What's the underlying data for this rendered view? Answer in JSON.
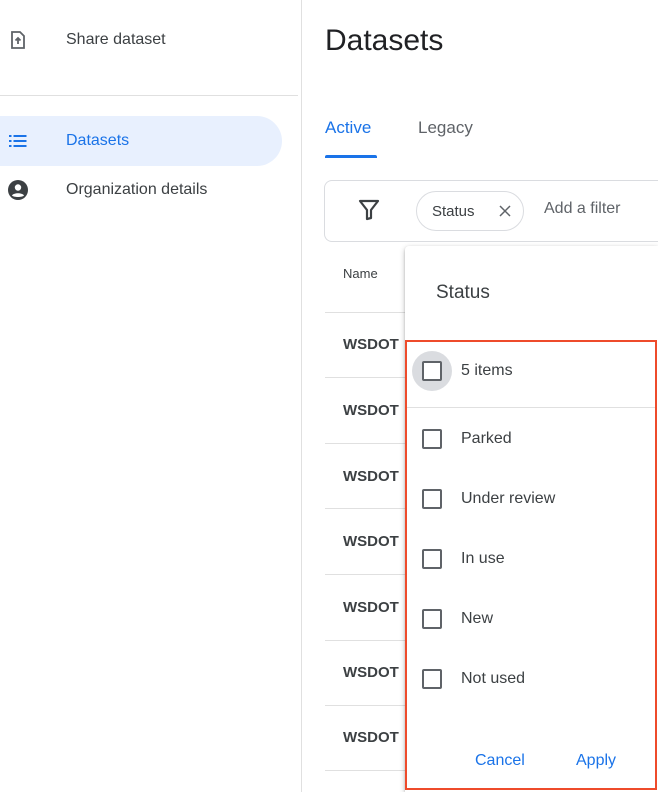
{
  "sidebar": {
    "items": [
      {
        "label": "Share dataset",
        "icon": "share-upload-icon"
      },
      {
        "label": "Datasets",
        "icon": "list-icon",
        "active": true
      },
      {
        "label": "Organization details",
        "icon": "account-circle-icon"
      }
    ]
  },
  "main": {
    "title": "Datasets",
    "tabs": [
      {
        "label": "Active",
        "active": true
      },
      {
        "label": "Legacy",
        "active": false
      }
    ],
    "filter": {
      "chip_label": "Status",
      "add_filter_label": "Add a filter"
    },
    "table": {
      "column_header": "Name",
      "rows": [
        "WSDOT",
        "WSDOT",
        "WSDOT",
        "WSDOT",
        "WSDOT",
        "WSDOT",
        "WSDOT"
      ]
    }
  },
  "status_popup": {
    "title": "Status",
    "select_all_label": "5 items",
    "options": [
      "Parked",
      "Under review",
      "In use",
      "New",
      "Not used"
    ],
    "cancel_label": "Cancel",
    "apply_label": "Apply"
  },
  "colors": {
    "accent": "#1a73e8",
    "active_nav_bg": "#e8f0fe",
    "highlight_border": "#ee4b2b"
  }
}
